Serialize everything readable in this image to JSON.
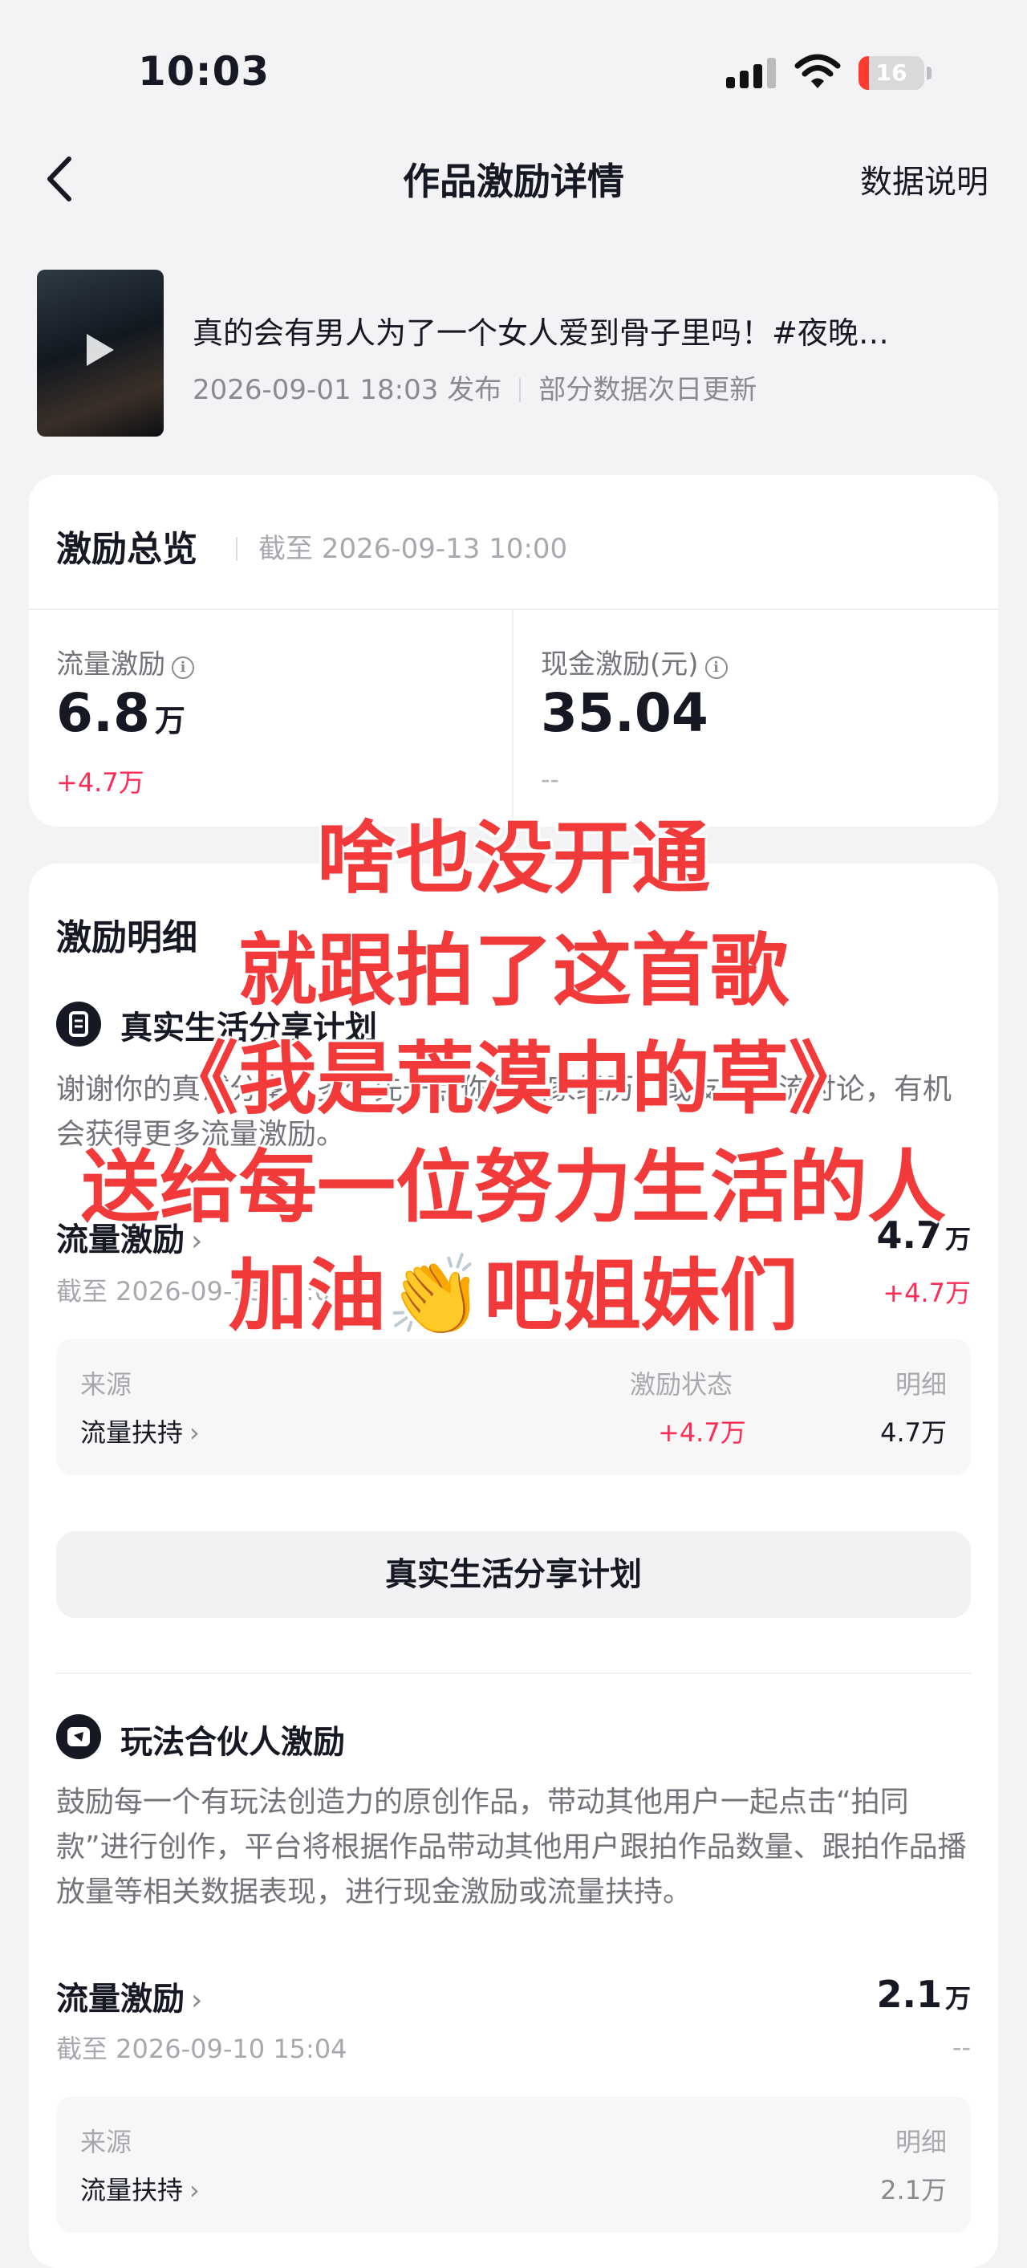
{
  "status_bar": {
    "time": "10:03",
    "battery": "16",
    "battery_level": 0.16
  },
  "nav": {
    "title": "作品激励详情",
    "right_link": "数据说明"
  },
  "video": {
    "title": "真的会有男人为了一个女人爱到骨子里吗！#夜晚…",
    "published": "2026-09-01 18:03 发布",
    "update_note": "部分数据次日更新"
  },
  "overview": {
    "title": "激励总览",
    "as_of": "截至 2026-09-13 10:00",
    "traffic": {
      "label": "流量激励",
      "value": "6.8",
      "unit": "万",
      "delta": "+4.7万"
    },
    "cash": {
      "label": "现金激励(元)",
      "value": "35.04",
      "delta": "--"
    }
  },
  "detail": {
    "title": "激励明细",
    "plans": [
      {
        "name": "真实生活分享计划",
        "desc": "谢谢你的真诚分享。多作先一点你的独家经历，或友起交流讨论，有机会获得更多流量激励。",
        "row_label": "流量激励",
        "row_date": "截至 2026-09-13 10:00",
        "value": "4.7",
        "unit": "万",
        "delta": "+4.7万",
        "table": {
          "headers": [
            "来源",
            "激励状态",
            "明细"
          ],
          "rows": [
            [
              "流量扶持",
              "+4.7万",
              "4.7万"
            ]
          ]
        },
        "button": "真实生活分享计划"
      },
      {
        "name": "玩法合伙人激励",
        "desc": "鼓励每一个有玩法创造力的原创作品，带动其他用户一起点击“拍同款”进行创作，平台将根据作品带动其他用户跟拍作品数量、跟拍作品播放量等相关数据表现，进行现金激励或流量扶持。",
        "row_label": "流量激励",
        "row_date": "截至 2026-09-10 15:04",
        "value": "2.1",
        "unit": "万",
        "delta": "--",
        "table": {
          "headers": [
            "来源",
            "明细"
          ],
          "rows": [
            [
              "流量扶持",
              "2.1万"
            ]
          ]
        }
      }
    ]
  },
  "overlay_caption": [
    "啥也没开通",
    "就跟拍了这首歌",
    "《我是荒漠中的草》",
    "送给每一位努力生活的人",
    "加油👏吧姐妹们"
  ],
  "colors": {
    "accent_red": "#fe2c55",
    "caption_red": "#f23a3a",
    "text": "#161823",
    "muted": "#8a8b91"
  }
}
